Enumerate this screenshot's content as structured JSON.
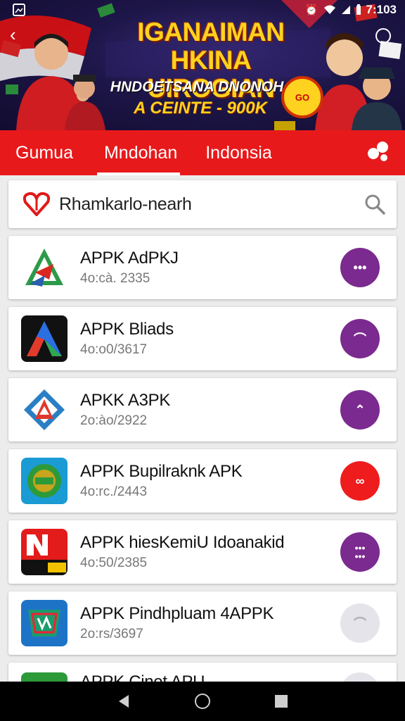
{
  "status": {
    "time": "7:103"
  },
  "banner": {
    "title": "IGANAIMAN HKINA UIROGIAN",
    "subtitle": "HNDOETSANA DNONOH",
    "promo": "A CEINTE - 900K",
    "badge": "GO"
  },
  "tabs": [
    {
      "label": "Gumua"
    },
    {
      "label": "Mndohan"
    },
    {
      "label": "Indonsia"
    }
  ],
  "search": {
    "value": "Rhamkarlo-nearh"
  },
  "apps": [
    {
      "name": "APPK AdPKJ",
      "meta": "4o:cà. 2335",
      "button_color": "#7b2a8f"
    },
    {
      "name": "APPK Bliads",
      "meta": "4o:o0/3617",
      "button_color": "#7b2a8f"
    },
    {
      "name": "APKK A3PK",
      "meta": "2o:ào/2922",
      "button_color": "#7b2a8f"
    },
    {
      "name": "APPK Bupilraknk APK",
      "meta": "4o:rc./2443",
      "button_color": "#ee1c1c"
    },
    {
      "name": "APPK hiesKemiU Idoanakid",
      "meta": "4o:50/2385",
      "button_color": "#7b2a8f"
    },
    {
      "name": "APPK Pindhpluam 4APPK",
      "meta": "2o:rs/3697",
      "button_color": "#e4e4ea"
    },
    {
      "name": "APPK Cinet APU",
      "meta": "",
      "button_color": "#e4e4ea"
    }
  ],
  "colors": {
    "accent": "#e8191b",
    "purple": "#7b2a8f"
  }
}
